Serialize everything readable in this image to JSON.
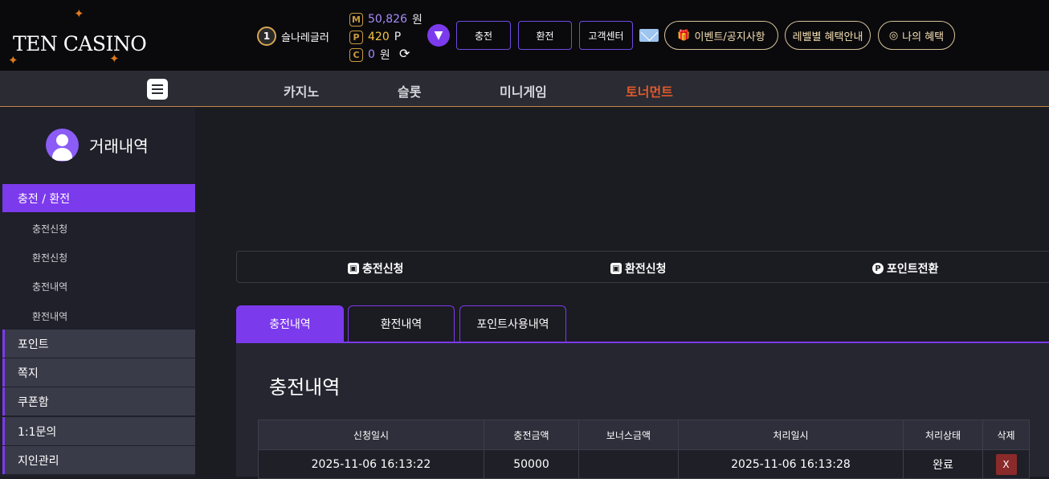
{
  "brand": {
    "logo_text": "TEN CASINO"
  },
  "user": {
    "level": "1",
    "name": "슬나레글러"
  },
  "wallet": {
    "m_icon": "M",
    "m_value": "50,826",
    "m_unit": "원",
    "p_icon": "P",
    "p_value": "420",
    "p_unit": "P",
    "c_icon": "C",
    "c_value": "0",
    "c_unit": "원"
  },
  "header_buttons": {
    "deposit": "충전",
    "withdraw": "환전",
    "support": "고객센터"
  },
  "header_pills": {
    "events": "이벤트/공지사항",
    "level_benefits": "레벨별 혜택안내",
    "my_benefits": "나의 혜택"
  },
  "nav": {
    "casino": "카지노",
    "slot": "슬롯",
    "minigame": "미니게임",
    "tournament": "토너먼트"
  },
  "sidebar": {
    "title": "거래내역",
    "categories": {
      "charge_exchange": "충전 / 환전",
      "point": "포인트",
      "message": "쪽지",
      "coupon": "쿠폰함",
      "inquiry": "1:1문의",
      "friends": "지인관리"
    },
    "subs": [
      "충전신청",
      "환전신청",
      "충전내역",
      "환전내역"
    ]
  },
  "quick_actions": {
    "deposit_request": "충전신청",
    "withdraw_request": "환전신청",
    "point_convert": "포인트전환"
  },
  "tabs": {
    "deposit_history": "충전내역",
    "withdraw_history": "환전내역",
    "point_history": "포인트사용내역"
  },
  "panel": {
    "title": "충전내역"
  },
  "table": {
    "headers": [
      "신청일시",
      "충전금액",
      "보너스금액",
      "처리일시",
      "처리상태",
      "삭제"
    ],
    "rows": [
      {
        "request_time": "2025-11-06 16:13:22",
        "amount": "50000",
        "bonus": "",
        "processed_time": "2025-11-06 16:13:28",
        "status": "완료",
        "delete": "X"
      }
    ]
  },
  "colors": {
    "accent": "#7c3aed",
    "gold": "#d8c49a",
    "tournament": "#e05a2a",
    "danger": "#8b2a2a"
  },
  "icons": [
    "maple-leaf-icon",
    "refresh-icon",
    "chevron-down-icon",
    "mail-icon",
    "gift-icon",
    "target-icon",
    "menu-icon",
    "user-icon",
    "cash-icon",
    "points-icon"
  ]
}
